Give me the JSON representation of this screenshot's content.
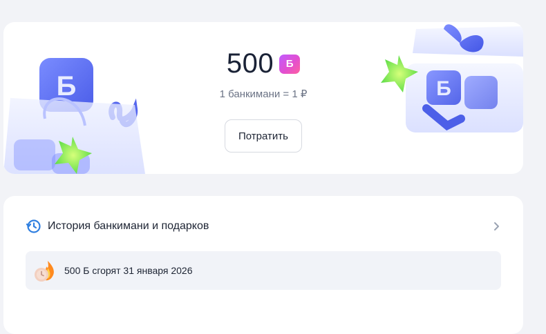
{
  "balance": {
    "amount": "500",
    "currency_badge": "Б",
    "rate": "1 банкимани = 1 ₽",
    "spend_label": "Потратить"
  },
  "history": {
    "title": "История банкимани и подарков",
    "expiry_notice": "500 Б сгорят 31 января 2026"
  },
  "icons": [
    "shopping-bag-illustration",
    "gift-box-illustration",
    "clock-history-icon",
    "chevron-right-icon",
    "fire-clock-icon"
  ],
  "colors": {
    "page_bg": "#f2f3f7",
    "card_bg": "#ffffff",
    "accent_blue": "#2f7fe0",
    "badge_purple": "#c05cff",
    "banner_bg": "#f1f3f8"
  }
}
